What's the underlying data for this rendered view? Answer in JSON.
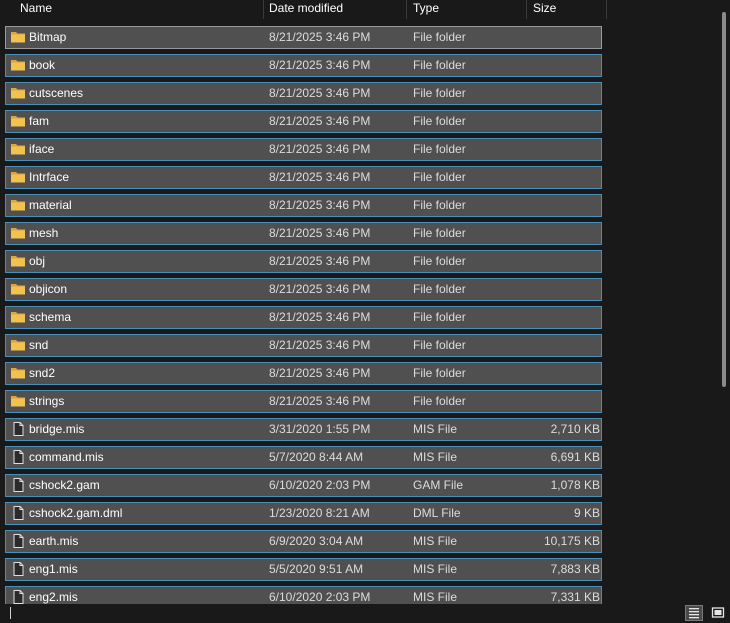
{
  "columns": {
    "name": "Name",
    "date": "Date modified",
    "type": "Type",
    "size": "Size"
  },
  "colors": {
    "background": "#191919",
    "row_fill": "#505050",
    "row_border": "#4a8fb8",
    "folder": "#f2c14e"
  },
  "files": [
    {
      "name": "Bitmap",
      "date": "8/21/2025 3:46 PM",
      "type": "File folder",
      "size": "",
      "icon": "folder-icon"
    },
    {
      "name": "book",
      "date": "8/21/2025 3:46 PM",
      "type": "File folder",
      "size": "",
      "icon": "folder-icon"
    },
    {
      "name": "cutscenes",
      "date": "8/21/2025 3:46 PM",
      "type": "File folder",
      "size": "",
      "icon": "folder-icon"
    },
    {
      "name": "fam",
      "date": "8/21/2025 3:46 PM",
      "type": "File folder",
      "size": "",
      "icon": "folder-icon"
    },
    {
      "name": "iface",
      "date": "8/21/2025 3:46 PM",
      "type": "File folder",
      "size": "",
      "icon": "folder-icon"
    },
    {
      "name": "Intrface",
      "date": "8/21/2025 3:46 PM",
      "type": "File folder",
      "size": "",
      "icon": "folder-icon"
    },
    {
      "name": "material",
      "date": "8/21/2025 3:46 PM",
      "type": "File folder",
      "size": "",
      "icon": "folder-icon"
    },
    {
      "name": "mesh",
      "date": "8/21/2025 3:46 PM",
      "type": "File folder",
      "size": "",
      "icon": "folder-icon"
    },
    {
      "name": "obj",
      "date": "8/21/2025 3:46 PM",
      "type": "File folder",
      "size": "",
      "icon": "folder-icon"
    },
    {
      "name": "objicon",
      "date": "8/21/2025 3:46 PM",
      "type": "File folder",
      "size": "",
      "icon": "folder-icon"
    },
    {
      "name": "schema",
      "date": "8/21/2025 3:46 PM",
      "type": "File folder",
      "size": "",
      "icon": "folder-icon"
    },
    {
      "name": "snd",
      "date": "8/21/2025 3:46 PM",
      "type": "File folder",
      "size": "",
      "icon": "folder-icon"
    },
    {
      "name": "snd2",
      "date": "8/21/2025 3:46 PM",
      "type": "File folder",
      "size": "",
      "icon": "folder-icon"
    },
    {
      "name": "strings",
      "date": "8/21/2025 3:46 PM",
      "type": "File folder",
      "size": "",
      "icon": "folder-icon"
    },
    {
      "name": "bridge.mis",
      "date": "3/31/2020 1:55 PM",
      "type": "MIS File",
      "size": "2,710 KB",
      "icon": "file-icon"
    },
    {
      "name": "command.mis",
      "date": "5/7/2020 8:44 AM",
      "type": "MIS File",
      "size": "6,691 KB",
      "icon": "file-icon"
    },
    {
      "name": "cshock2.gam",
      "date": "6/10/2020 2:03 PM",
      "type": "GAM File",
      "size": "1,078 KB",
      "icon": "file-icon"
    },
    {
      "name": "cshock2.gam.dml",
      "date": "1/23/2020 8:21 AM",
      "type": "DML File",
      "size": "9 KB",
      "icon": "file-icon"
    },
    {
      "name": "earth.mis",
      "date": "6/9/2020 3:04 AM",
      "type": "MIS File",
      "size": "10,175 KB",
      "icon": "file-icon"
    },
    {
      "name": "eng1.mis",
      "date": "5/5/2020 9:51 AM",
      "type": "MIS File",
      "size": "7,883 KB",
      "icon": "file-icon"
    },
    {
      "name": "eng2.mis",
      "date": "6/10/2020 2:03 PM",
      "type": "MIS File",
      "size": "7,331 KB",
      "icon": "file-icon"
    }
  ],
  "statusbar": {
    "details_view_icon": "details-view-icon",
    "tiles_view_icon": "large-icons-view-icon"
  }
}
